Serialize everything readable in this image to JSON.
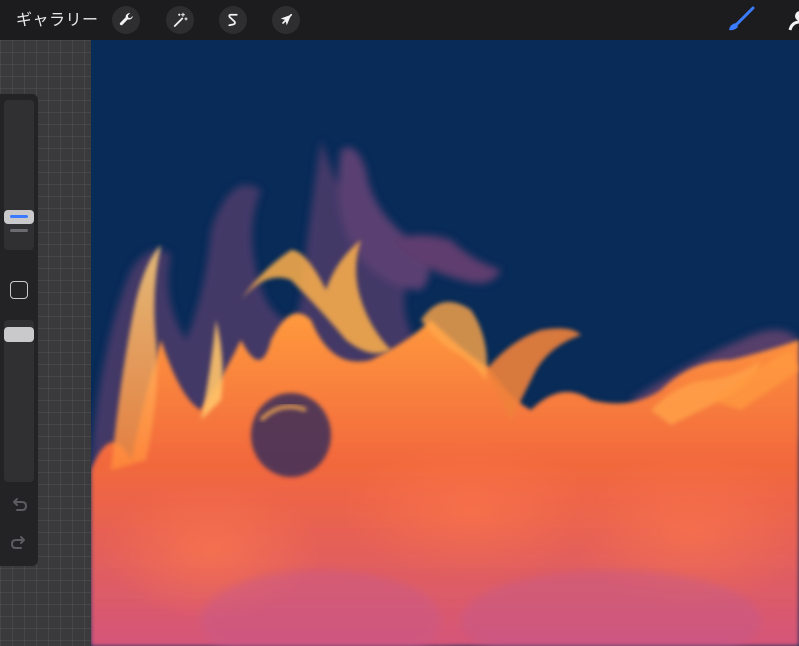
{
  "toolbar": {
    "gallery_label": "ギャラリー",
    "tools": [
      {
        "name": "actions",
        "icon": "wrench-icon"
      },
      {
        "name": "adjustments",
        "icon": "magic-wand-icon"
      },
      {
        "name": "selection",
        "icon": "selection-s-icon"
      },
      {
        "name": "transform",
        "icon": "arrow-cursor-icon"
      }
    ],
    "right_tools": [
      {
        "name": "brush",
        "icon": "brush-icon",
        "active": true
      },
      {
        "name": "smudge",
        "icon": "smudge-icon",
        "active": false
      }
    ]
  },
  "sidebar": {
    "brush_size_icon": "size-slider",
    "modify_icon": "square-icon",
    "opacity_icon": "opacity-slider",
    "undo_icon": "undo-arrow-icon",
    "redo_icon": "redo-arrow-icon"
  },
  "canvas": {
    "background_color": "#082b58",
    "subject": "flames"
  },
  "colors": {
    "accent": "#3b7bff",
    "toolbar_bg": "#1c1c1e",
    "sidebar_bg": "#232325",
    "flame_light": "#ffb04a",
    "flame_mid": "#f26a3a",
    "flame_dark": "#5a3a6a"
  }
}
